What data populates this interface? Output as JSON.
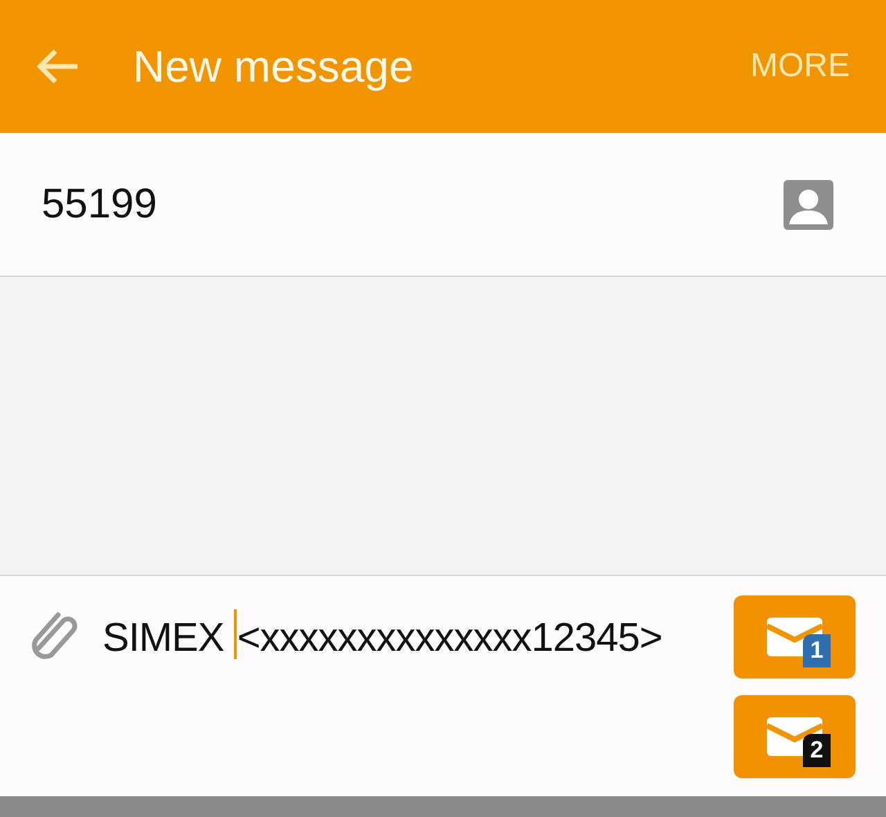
{
  "header": {
    "title": "New message",
    "action": "MORE"
  },
  "recipient": {
    "value": "55199"
  },
  "composer": {
    "text_before_cursor": "SIMEX ",
    "text_after_cursor": "<xxxxxxxxxxxxxx12345>"
  },
  "send_buttons": [
    {
      "sim": "1",
      "color": "#2f6fb0"
    },
    {
      "sim": "2",
      "color": "#111111"
    }
  ]
}
